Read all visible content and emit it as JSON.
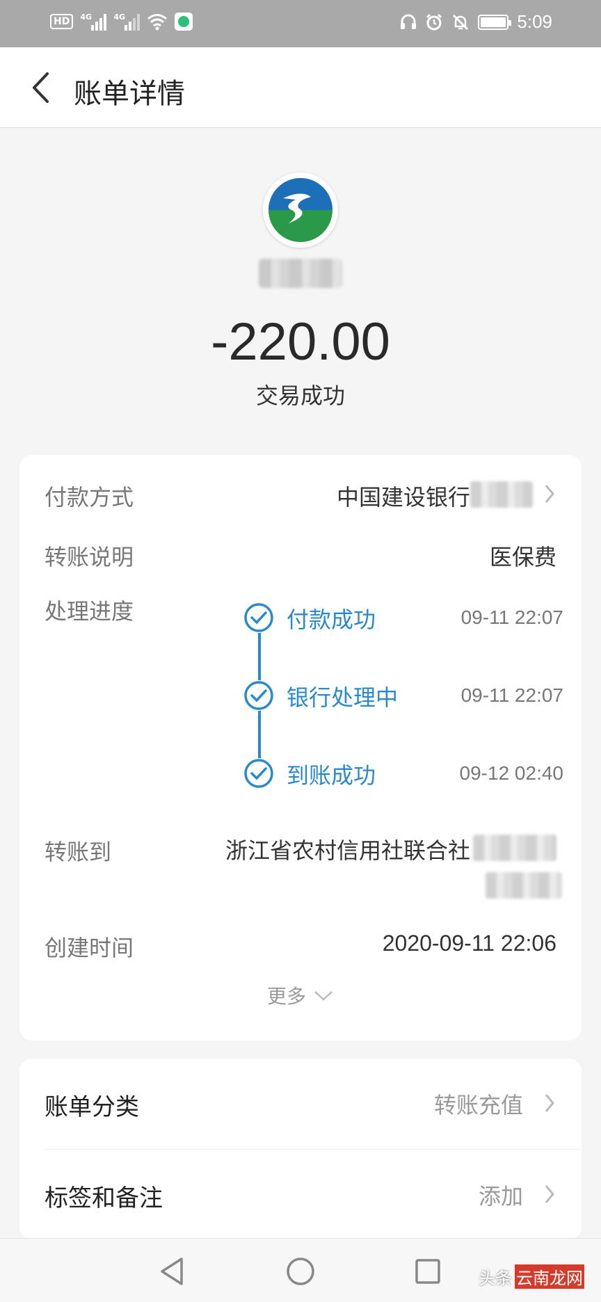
{
  "status_bar": {
    "hd": "HD",
    "sim1_type": "4G",
    "sim2_type": "4G",
    "time": "5:09"
  },
  "header": {
    "title": "账单详情",
    "back_icon": "back-arrow-icon"
  },
  "summary": {
    "amount": "-220.00",
    "status": "交易成功"
  },
  "details": {
    "payment_method": {
      "label": "付款方式",
      "value": "中国建设银行"
    },
    "transfer_note": {
      "label": "转账说明",
      "value": "医保费"
    },
    "progress": {
      "label": "处理进度",
      "steps": [
        {
          "label": "付款成功",
          "time": "09-11 22:07"
        },
        {
          "label": "银行处理中",
          "time": "09-11 22:07"
        },
        {
          "label": "到账成功",
          "time": "09-12 02:40"
        }
      ]
    },
    "transfer_to": {
      "label": "转账到",
      "value": "浙江省农村信用社联合社"
    },
    "created_time": {
      "label": "创建时间",
      "value": "2020-09-11 22:06"
    },
    "more_label": "更多"
  },
  "extra": {
    "category": {
      "label": "账单分类",
      "value": "转账充值"
    },
    "tags": {
      "label": "标签和备注",
      "value": "添加"
    }
  },
  "colors": {
    "accent": "#2a8ac9",
    "status_bar": "#a9a9a9",
    "background": "#f5f5f5"
  },
  "watermark": {
    "prefix": "头条",
    "site": "云南龙网"
  }
}
